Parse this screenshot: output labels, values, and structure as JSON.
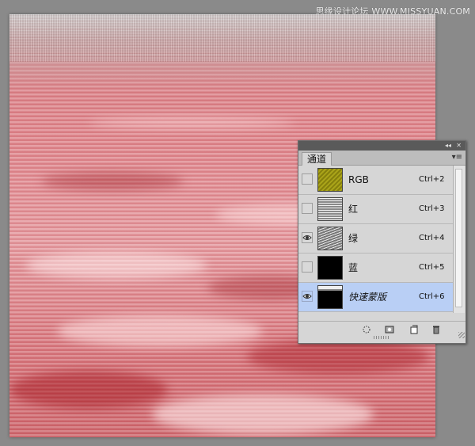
{
  "watermark": "思缘设计论坛 WWW.MISSYUAN.COM",
  "panel": {
    "tab_label": "通道",
    "collapse_glyph": "◂◂",
    "close_glyph": "✕",
    "menu_glyph": "▾≡",
    "rows": [
      {
        "label": "RGB",
        "shortcut": "Ctrl+2",
        "visible": false,
        "thumb": "rgb-thumbnail-icon",
        "selected": false
      },
      {
        "label": "红",
        "shortcut": "Ctrl+3",
        "visible": false,
        "thumb": "gray-thumbnail-icon",
        "selected": false
      },
      {
        "label": "绿",
        "shortcut": "Ctrl+4",
        "visible": true,
        "thumb": "gray-thumbnail-icon",
        "selected": false
      },
      {
        "label": "蓝",
        "shortcut": "Ctrl+5",
        "visible": false,
        "thumb": "black-thumbnail-icon",
        "selected": false
      },
      {
        "label": "快速蒙版",
        "shortcut": "Ctrl+6",
        "visible": true,
        "thumb": "mask-thumbnail-icon",
        "selected": true
      }
    ],
    "bottom_icons": [
      "load-selection-icon",
      "save-selection-icon",
      "new-channel-icon",
      "delete-channel-icon"
    ]
  },
  "colors": {
    "background": "#8a8a8a",
    "canvas_red": "#e08a90",
    "selected_row": "#b9cff5",
    "panel_bg": "#d6d6d6"
  }
}
